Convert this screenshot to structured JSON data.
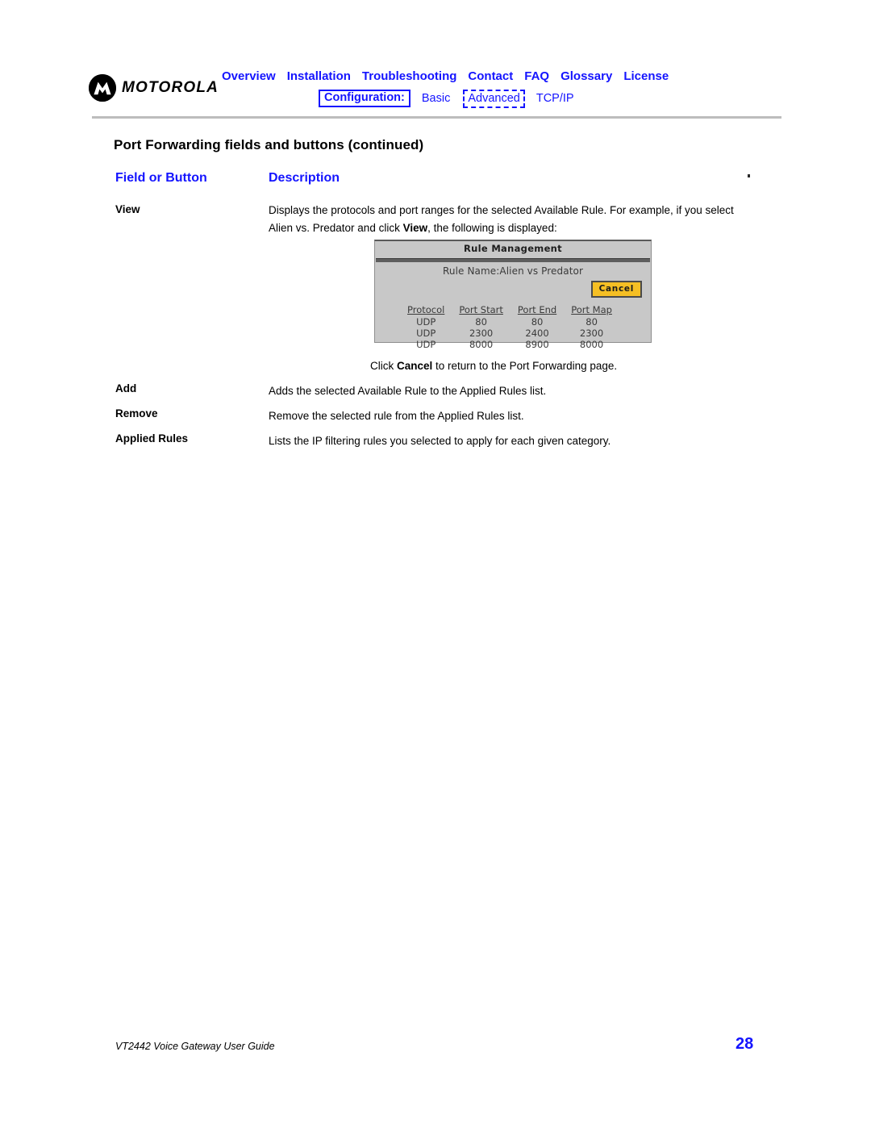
{
  "brand": {
    "name": "MOTOROLA",
    "logo_icon": "motorola-batwing-icon"
  },
  "nav": {
    "primary": [
      {
        "label": "Overview"
      },
      {
        "label": "Installation"
      },
      {
        "label": "Troubleshooting"
      },
      {
        "label": "Contact"
      },
      {
        "label": "FAQ"
      },
      {
        "label": "Glossary"
      },
      {
        "label": "License"
      }
    ],
    "configuration_label": "Configuration:",
    "secondary": [
      {
        "label": "Basic",
        "selected": false
      },
      {
        "label": "Advanced",
        "selected": true
      },
      {
        "label": "TCP/IP",
        "selected": false
      }
    ],
    "link_color": "#1414ff"
  },
  "document": {
    "title": "Port Forwarding fields and buttons (continued)",
    "columns": {
      "field": "Field or Button",
      "description": "Description"
    },
    "rows": [
      {
        "label": "View",
        "desc_part1": "Displays the protocols and port ranges for the selected Available Rule. For example, if you select Alien vs. Predator and click ",
        "desc_bold": "View",
        "desc_part2": ", the following is displayed:"
      },
      {
        "label": "Add",
        "description": "Adds the selected Available Rule to the Applied Rules list."
      },
      {
        "label": "Remove",
        "description": "Remove the selected rule from the Applied Rules list."
      },
      {
        "label": "Applied Rules",
        "description": "Lists the IP filtering rules you selected to apply for each given category."
      }
    ],
    "click_cancel_note": {
      "part1": "Click ",
      "bold": "Cancel",
      "part2": " to return to the Port Forwarding page."
    }
  },
  "screenshot": {
    "title": "Rule Management",
    "rule_name_label": "Rule Name:",
    "rule_name_value": "Alien vs Predator",
    "cancel_button": "Cancel",
    "cancel_button_color": "#f5bf24",
    "headers": [
      "Protocol",
      "Port Start",
      "Port End",
      "Port Map"
    ],
    "rows": [
      [
        "UDP",
        "80",
        "80",
        "80"
      ],
      [
        "UDP",
        "2300",
        "2400",
        "2300"
      ],
      [
        "UDP",
        "8000",
        "8900",
        "8000"
      ]
    ]
  },
  "footer": {
    "guide_title": "VT2442 Voice Gateway User Guide",
    "page_number": "28"
  }
}
